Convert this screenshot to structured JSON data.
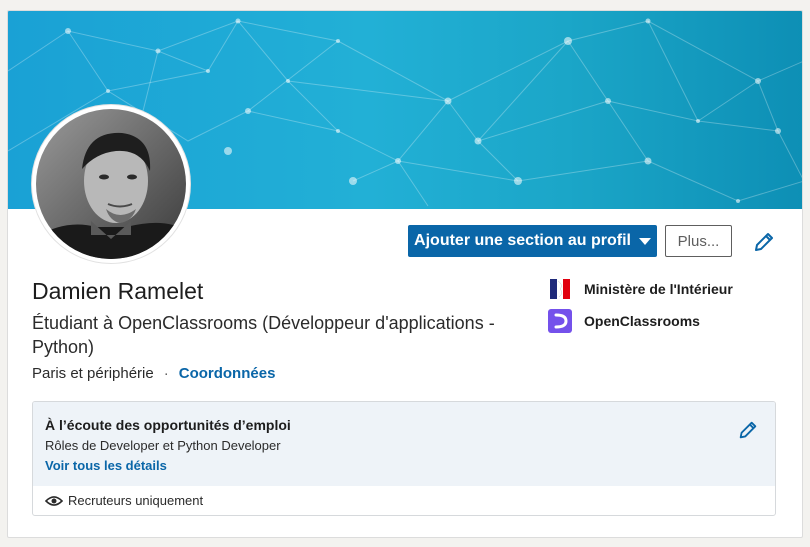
{
  "profile": {
    "name": "Damien Ramelet",
    "headline": "Étudiant à OpenClassrooms (Développeur d'applications - Python)",
    "location": "Paris et périphérie",
    "separator": "·",
    "contact_link": "Coordonnées"
  },
  "actions": {
    "add_section_label": "Ajouter une section au profil",
    "more_label": "Plus..."
  },
  "companies": [
    {
      "name": "Ministère de l'Intérieur",
      "logo_icon": "ministere-interieur-logo"
    },
    {
      "name": "OpenClassrooms",
      "logo_icon": "openclassrooms-logo"
    }
  ],
  "open_to_work": {
    "title": "À l’écoute des opportunités d’emploi",
    "roles": "Rôles de Developer et Python Developer",
    "details_link": "Voir tous les détails",
    "visibility": "Recruteurs uniquement"
  },
  "colors": {
    "accent": "#0a66a8",
    "banner": "#1aa1d5",
    "openclassrooms": "#7451eb"
  }
}
